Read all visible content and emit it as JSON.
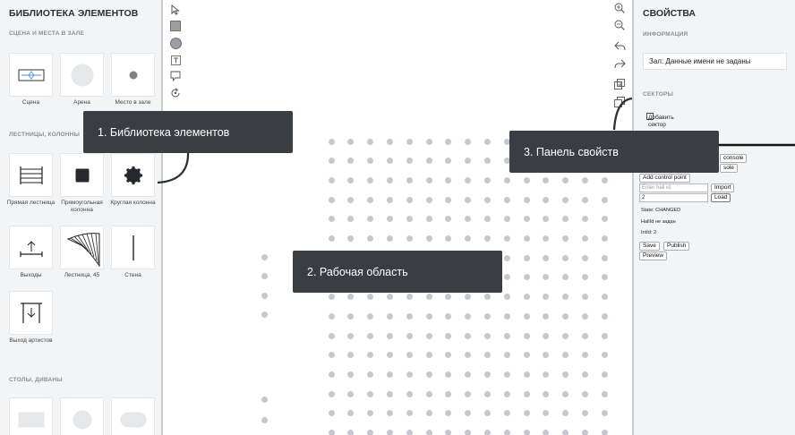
{
  "library": {
    "title": "БИБЛИОТЕКА ЭЛЕМЕНТОВ",
    "sections": [
      {
        "title": "СЦЕНА И МЕСТА В ЗАЛЕ",
        "items": [
          {
            "label": "Сцена",
            "icon": "stage-icon"
          },
          {
            "label": "Арена",
            "icon": "arena-icon"
          },
          {
            "label": "Место в зале",
            "icon": "seat-icon"
          }
        ]
      },
      {
        "title": "ЛЕСТНИЦЫ, КОЛОННЫ",
        "items": [
          {
            "label": "Прямая лестница",
            "icon": "straight-stairs-icon"
          },
          {
            "label": "Прямоугольная колонна",
            "icon": "rect-column-icon"
          },
          {
            "label": "Круглая колонна",
            "icon": "round-column-icon"
          },
          {
            "label": "Выходы",
            "icon": "exit-icon"
          },
          {
            "label": "Лестница, 45",
            "icon": "stairs-45-icon"
          },
          {
            "label": "Стена",
            "icon": "wall-icon"
          },
          {
            "label": "Выход артистов",
            "icon": "artists-exit-icon"
          }
        ]
      },
      {
        "title": "СТОЛЫ, ДИВАНЫ",
        "items": [
          {
            "label": "",
            "icon": "rect-table-icon"
          },
          {
            "label": "",
            "icon": "round-table-icon"
          },
          {
            "label": "",
            "icon": "sofa-icon"
          }
        ]
      }
    ]
  },
  "tools_left": [
    "cursor-icon",
    "rectangle-tool-icon",
    "circle-tool-icon",
    "text-tool-icon",
    "comment-tool-icon",
    "rotate-tool-icon"
  ],
  "tools_right": [
    "zoom-in-icon",
    "zoom-out-icon",
    "undo-icon",
    "redo-icon",
    "duplicate-icon",
    "layers-icon"
  ],
  "properties": {
    "title": "СВОЙСТВА",
    "info_section": "ИНФОРМАЦИЯ",
    "hall_prefix": "Зал:",
    "hall_value": "Данные имени не заданы",
    "sectors_section": "СЕКТОРЫ",
    "add_sector_line1": "Добавить",
    "add_sector_line2": "сектор",
    "console_btn_1": "console",
    "console_btn_2": "sole",
    "add_control_point": "Add control point",
    "hall_id_placeholder": "Enter hall id:",
    "import_btn": "Import",
    "hall_id_value": "2",
    "load_btn": "Load",
    "state_text": "State: CHANGED",
    "hallid_text": "HallId не задан",
    "intid_text": "IntId: 2",
    "save_btn": "Save",
    "publish_btn": "Publish",
    "preview_btn": "Preview"
  },
  "callouts": {
    "library": "1. Библиотека элементов",
    "workspace": "2. Рабочая область",
    "properties": "3. Панель свойств"
  },
  "colors": {
    "panel_bg": "#f3f4f6",
    "callout_bg": "#3a3d43",
    "seat": "#c5c9cf",
    "accent_blue": "#4a90e2"
  }
}
